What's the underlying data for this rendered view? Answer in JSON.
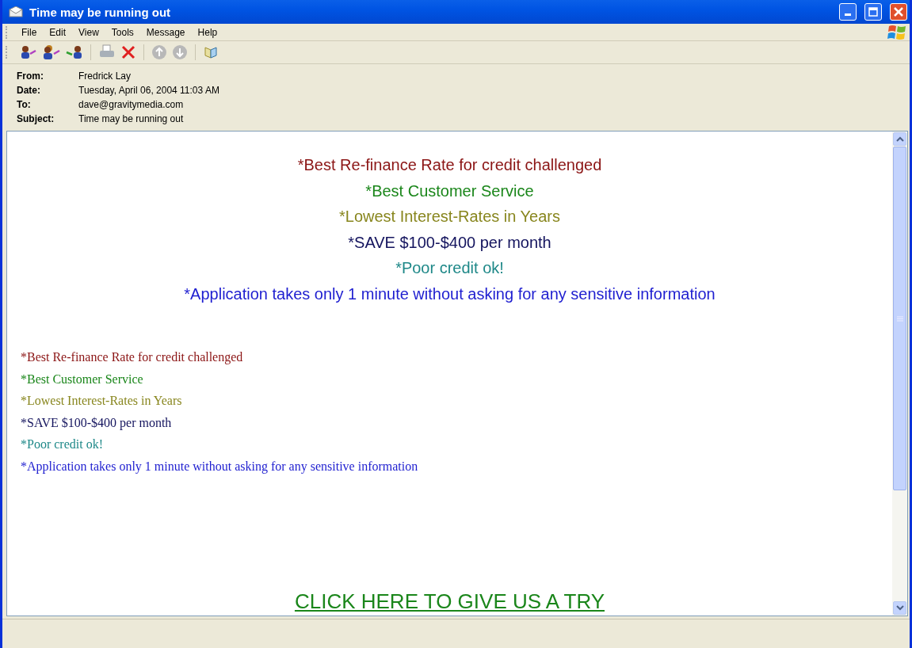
{
  "window": {
    "title": "Time may be running out"
  },
  "menu": [
    "File",
    "Edit",
    "View",
    "Tools",
    "Message",
    "Help"
  ],
  "header": [
    {
      "label": "From:",
      "value": "Fredrick Lay"
    },
    {
      "label": "Date:",
      "value": "Tuesday, April 06, 2004 11:03 AM"
    },
    {
      "label": "To:",
      "value": "dave@gravitymedia.com"
    },
    {
      "label": "Subject:",
      "value": " Time may be running out"
    }
  ],
  "message": {
    "large_lines": [
      {
        "text": "*Best Re-finance Rate for credit challenged",
        "color": "#8b1414"
      },
      {
        "text": "*Best Customer Service",
        "color": "#1a861a"
      },
      {
        "text": "*Lowest Interest-Rates in Years",
        "color": "#88861e"
      },
      {
        "text": "*SAVE $100-$400 per month",
        "color": "#14145e"
      },
      {
        "text": "*Poor credit ok!",
        "color": "#1e8888"
      },
      {
        "text": "*Application takes only 1 minute without asking for any sensitive information",
        "color": "#1e1ed0"
      }
    ],
    "small_lines": [
      {
        "text": "*Best Re-finance Rate for credit challenged",
        "color": "#8b1414"
      },
      {
        "text": "*Best Customer Service",
        "color": "#1a861a"
      },
      {
        "text": "*Lowest Interest-Rates in Years",
        "color": "#88861e"
      },
      {
        "text": "*SAVE $100-$400 per month",
        "color": "#14145e"
      },
      {
        "text": "*Poor credit ok!",
        "color": "#1e8888"
      },
      {
        "text": "*Application takes only 1 minute without asking for any sensitive information",
        "color": "#1e1ed0"
      }
    ],
    "link": "CLICK HERE TO GIVE US A TRY"
  }
}
